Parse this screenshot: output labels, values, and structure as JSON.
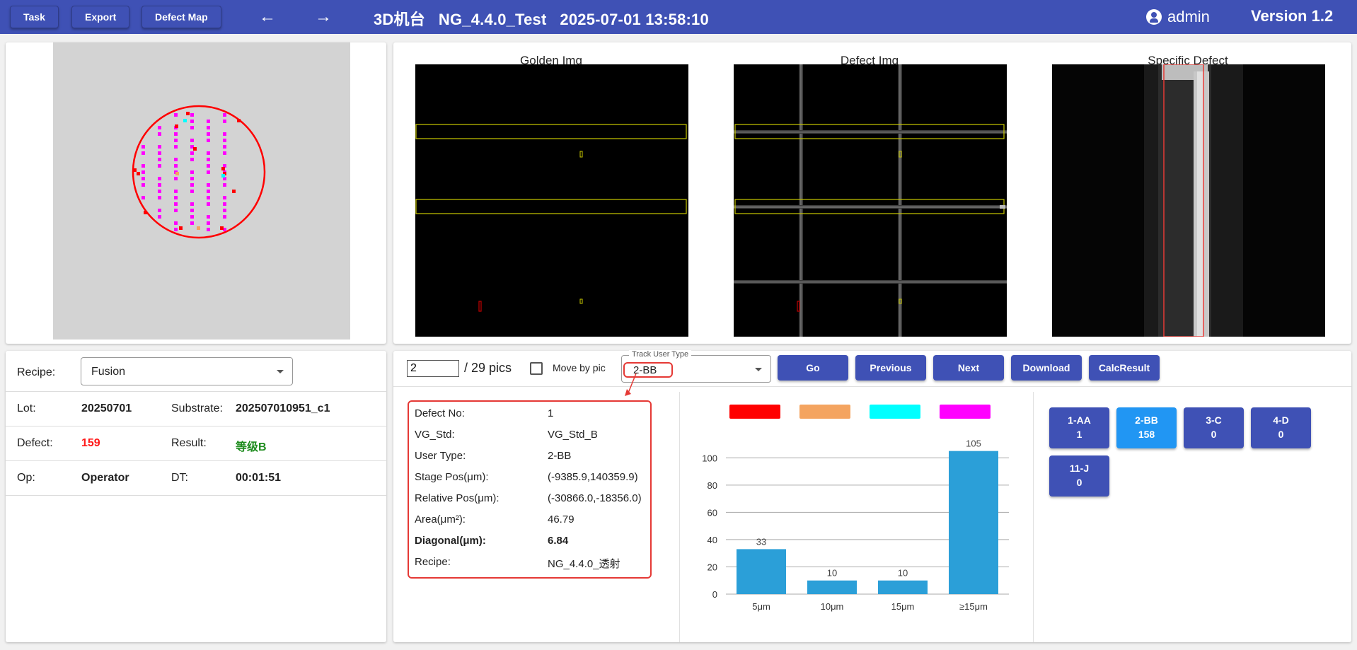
{
  "toolbar": {
    "task_label": "Task",
    "export_label": "Export",
    "defect_map_label": "Defect Map",
    "back_icon": "arrow-left-icon",
    "forward_icon": "arrow-right-icon",
    "title": "3D机台   NG_4.4.0_Test   2025-07-01 13:58:10",
    "user": "admin",
    "version": "Version 1.2"
  },
  "images": {
    "golden_title": "Golden Img",
    "defect_title": "Defect Img",
    "specific_title": "Specific Defect"
  },
  "info": {
    "recipe_label": "Recipe:",
    "recipe_value": "Fusion",
    "lot_label": "Lot:",
    "lot_value": "20250701",
    "substrate_label": "Substrate:",
    "substrate_value": "202507010951_c1",
    "defect_label": "Defect:",
    "defect_value": "159",
    "result_label": "Result:",
    "result_value": "等级B",
    "op_label": "Op:",
    "op_value": "Operator",
    "dt_label": "DT:",
    "dt_value": "00:01:51"
  },
  "nav": {
    "page_value": "2",
    "total": "/ 29 pics",
    "move_by_pic": "Move by pic",
    "track_label": "Track User Type",
    "track_value": "2-BB",
    "go": "Go",
    "previous": "Previous",
    "next": "Next",
    "download": "Download",
    "calc": "CalcResult"
  },
  "detail": [
    {
      "label": "Defect No:",
      "value": "1"
    },
    {
      "label": "VG_Std:",
      "value": "VG_Std_B"
    },
    {
      "label": "User Type:",
      "value": "2-BB"
    },
    {
      "label": "Stage Pos(μm):",
      "value": "(-9385.9,140359.9)"
    },
    {
      "label": "Relative Pos(μm):",
      "value": "(-30866.0,-18356.0)"
    },
    {
      "label": "Area(μm²):",
      "value": "46.79"
    },
    {
      "label": "Diagonal(μm):",
      "value": "6.84"
    },
    {
      "label": "Recipe:",
      "value": "NG_4.4.0_透射"
    }
  ],
  "types": [
    {
      "name": "1-AA",
      "count": "1"
    },
    {
      "name": "2-BB",
      "count": "158"
    },
    {
      "name": "3-C",
      "count": "0"
    },
    {
      "name": "4-D",
      "count": "0"
    },
    {
      "name": "11-J",
      "count": "0"
    }
  ],
  "colors": {
    "primary": "#3f51b5",
    "active": "#2196f3",
    "bar": "#2b9fd8",
    "legend": [
      "#ff0000",
      "#f4a460",
      "#00ffff",
      "#ff00ff"
    ]
  },
  "chart_data": {
    "type": "bar",
    "categories": [
      "5μm",
      "10μm",
      "15μm",
      "≥15μm"
    ],
    "values": [
      33,
      10,
      10,
      105
    ],
    "ylim": [
      0,
      110
    ],
    "yticks": [
      0,
      20,
      40,
      60,
      80,
      100
    ],
    "legend_colors": [
      "#ff0000",
      "#f4a460",
      "#00ffff",
      "#ff00ff"
    ],
    "grid": true
  }
}
